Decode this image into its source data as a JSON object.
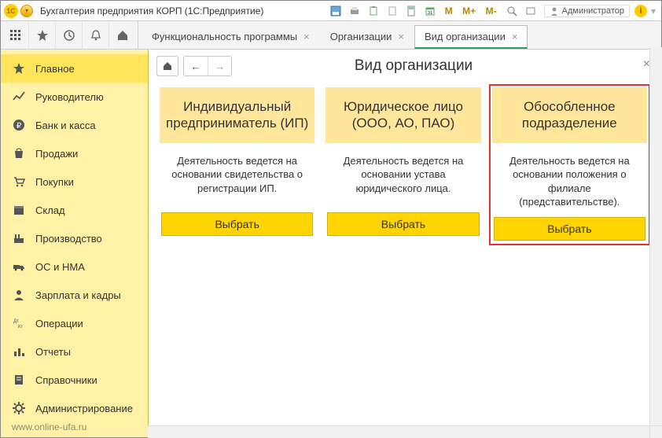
{
  "titlebar": {
    "app_title": "Бухгалтерия предприятия КОРП  (1С:Предприятие)",
    "user": "Администратор",
    "m": "M",
    "m_plus": "M+",
    "m_minus": "M-"
  },
  "tabs": [
    {
      "label": "Функциональность программы",
      "active": false
    },
    {
      "label": "Организации",
      "active": false
    },
    {
      "label": "Вид организации",
      "active": true
    }
  ],
  "sidebar": {
    "items": [
      {
        "label": "Главное",
        "icon": "star"
      },
      {
        "label": "Руководителю",
        "icon": "chart"
      },
      {
        "label": "Банк и касса",
        "icon": "ruble"
      },
      {
        "label": "Продажи",
        "icon": "bag"
      },
      {
        "label": "Покупки",
        "icon": "cart"
      },
      {
        "label": "Склад",
        "icon": "box"
      },
      {
        "label": "Производство",
        "icon": "factory"
      },
      {
        "label": "ОС и НМА",
        "icon": "truck"
      },
      {
        "label": "Зарплата и кадры",
        "icon": "person"
      },
      {
        "label": "Операции",
        "icon": "dtkt"
      },
      {
        "label": "Отчеты",
        "icon": "bars"
      },
      {
        "label": "Справочники",
        "icon": "book"
      },
      {
        "label": "Администрирование",
        "icon": "gear"
      }
    ],
    "footer": "www.online-ufa.ru"
  },
  "page": {
    "title": "Вид организации",
    "cards": [
      {
        "title": "Индивидуальный предприниматель (ИП)",
        "desc": "Деятельность ведется на основании свидетельства о регистрации ИП.",
        "button": "Выбрать",
        "highlight": false
      },
      {
        "title": "Юридическое лицо (ООО, АО, ПАО)",
        "desc": "Деятельность ведется на основании устава юридического лица.",
        "button": "Выбрать",
        "highlight": false
      },
      {
        "title": "Обособленное подразделение",
        "desc": "Деятельность ведется на основании положения о филиале (представительстве).",
        "button": "Выбрать",
        "highlight": true
      }
    ]
  }
}
